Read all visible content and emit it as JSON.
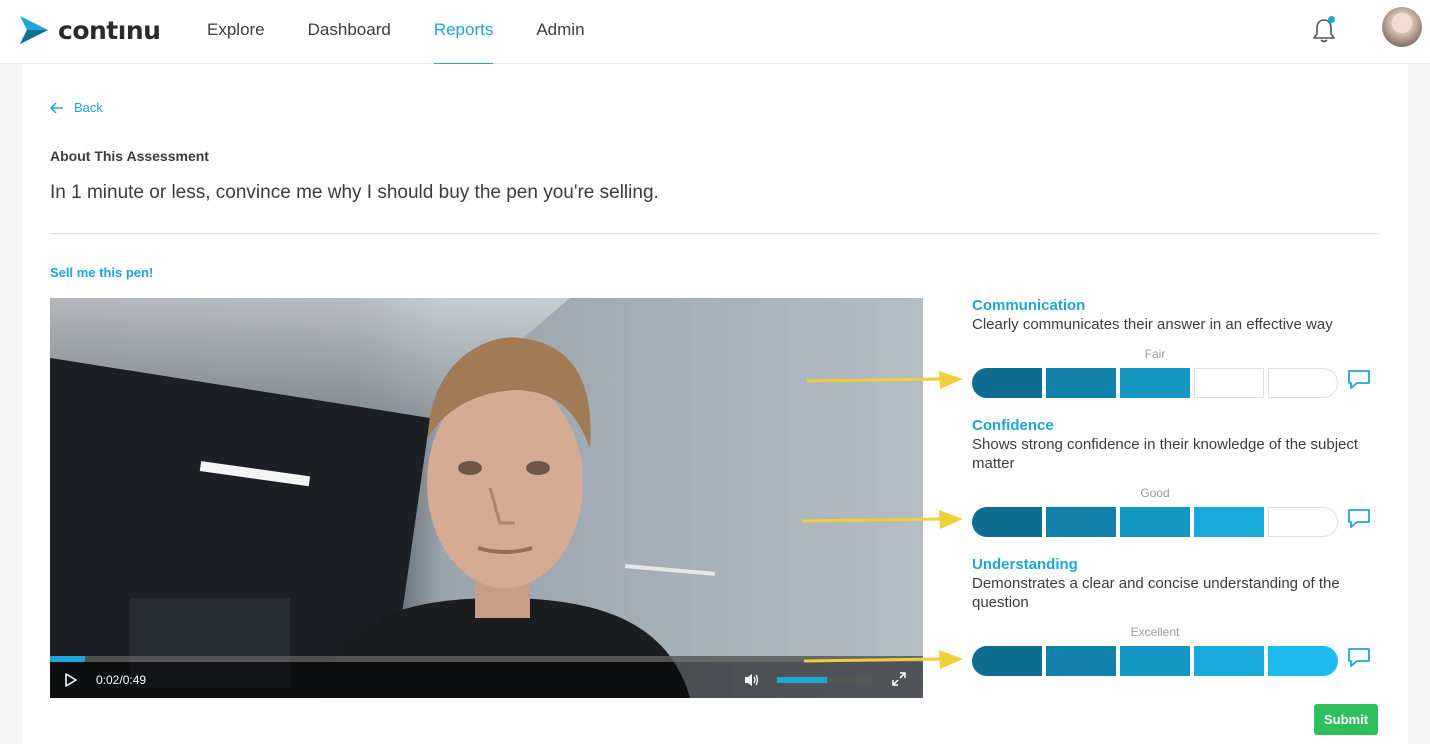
{
  "brand": {
    "name": "contınu"
  },
  "nav": {
    "items": [
      {
        "label": "Explore",
        "active": false
      },
      {
        "label": "Dashboard",
        "active": false
      },
      {
        "label": "Reports",
        "active": true
      },
      {
        "label": "Admin",
        "active": false
      }
    ]
  },
  "icons": {
    "bell": "bell-icon",
    "avatar": "user-avatar",
    "back": "arrow-left-icon",
    "play": "play-icon",
    "volume": "volume-icon",
    "fullscreen": "fullscreen-icon",
    "comment": "speech-bubble-icon"
  },
  "colors": {
    "accent": "#1fa6d6",
    "submit": "#2fbf5d",
    "annotation_arrow": "#f0cf3c"
  },
  "back": {
    "label": "Back"
  },
  "about": {
    "title": "About This Assessment",
    "question": "In 1 minute or less, convince me why I should buy the pen you're selling."
  },
  "section": {
    "title": "Sell me this pen!"
  },
  "video": {
    "time": "0:02/0:49",
    "progress": 0.04,
    "volume": 0.5
  },
  "criteria": [
    {
      "name": "Communication",
      "description": "Clearly communicates their answer in an effective way",
      "rating_label": "Fair",
      "rating": 3,
      "max": 5
    },
    {
      "name": "Confidence",
      "description": "Shows strong confidence in their knowledge of the subject matter",
      "rating_label": "Good",
      "rating": 4,
      "max": 5
    },
    {
      "name": "Understanding",
      "description": "Demonstrates a clear and concise understanding of the question",
      "rating_label": "Excellent",
      "rating": 5,
      "max": 5
    }
  ],
  "submit": {
    "label": "Submit"
  }
}
